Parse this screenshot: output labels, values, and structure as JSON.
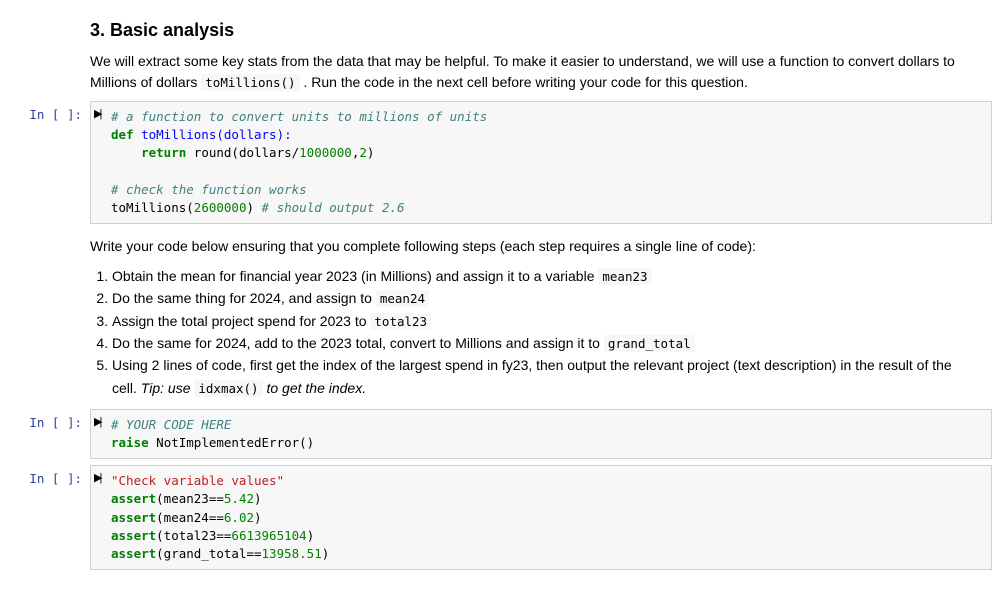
{
  "heading": "3. Basic analysis",
  "intro_part1": "We will extract some key stats from the data that may be helpful. To make it easier to understand, we will use a function to convert dollars to Millions of dollars ",
  "intro_code": "toMillions()",
  "intro_part2": " . Run the code in the next cell before writing your code for this question.",
  "prompt_label": "In [ ]:",
  "cell1": {
    "c1": "# a function to convert units to millions of units",
    "kw_def": "def",
    "fn_name": " toMillions(dollars):",
    "kw_return": "return",
    "ret_expr1": " round(dollars/",
    "num_million": "1000000",
    "ret_expr2": ",",
    "num_two": "2",
    "ret_expr3": ")",
    "c2": "# check the function works",
    "call1": "toMillions(",
    "num_check": "2600000",
    "call2": ") ",
    "c3": "# should output 2.6"
  },
  "instructions": "Write your code below ensuring that you complete following steps (each step requires a single line of code):",
  "steps": {
    "s1a": "Obtain the mean for financial year 2023 (in Millions) and assign it to a variable ",
    "s1code": "mean23",
    "s2a": "Do the same thing for 2024, and assign to ",
    "s2code": "mean24",
    "s3a": "Assign the total project spend for 2023 to ",
    "s3code": "total23",
    "s4a": "Do the same for 2024, add to the 2023 total, convert to Millions and assign it to ",
    "s4code": "grand_total",
    "s5a": "Using 2 lines of code, first get the index of the largest spend in fy23, then output the relevant project (text description) in the result of the cell. ",
    "s5tip": "Tip: use ",
    "s5code": "idxmax()",
    "s5b": " to get the index."
  },
  "cell2": {
    "c1": "# YOUR CODE HERE",
    "kw_raise": "raise",
    "err": " NotImplementedError()"
  },
  "cell3": {
    "str1": "\"Check variable values\"",
    "kw_assert": "assert",
    "a1a": "(mean23==",
    "a1n": "5.42",
    "a1b": ")",
    "a2a": "(mean24==",
    "a2n": "6.02",
    "a2b": ")",
    "a3a": "(total23==",
    "a3n": "6613965104",
    "a3b": ")",
    "a4a": "(grand_total==",
    "a4n": "13958.51",
    "a4b": ")"
  }
}
